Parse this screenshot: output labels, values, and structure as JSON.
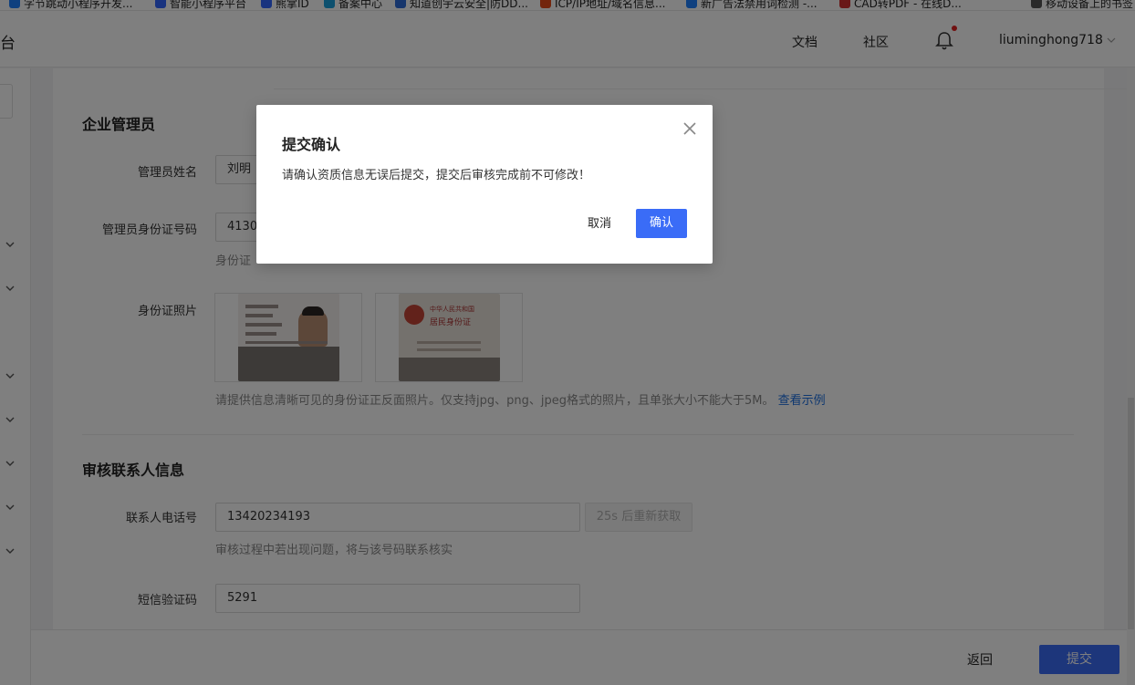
{
  "bookmarks": [
    {
      "label": "字节跳动小程序开发...",
      "color": "#1e80ff"
    },
    {
      "label": "智能小程序平台",
      "color": "#3266ff"
    },
    {
      "label": "熊掌ID",
      "color": "#3266ff"
    },
    {
      "label": "备案中心",
      "color": "#1aa0dc"
    },
    {
      "label": "知道创宇云安全|防DD...",
      "color": "#2e6dd8"
    },
    {
      "label": "ICP/IP地址/域名信息...",
      "color": "#e64a19"
    },
    {
      "label": "新广告法禁用词检测 -...",
      "color": "#1e80ff"
    },
    {
      "label": "CAD转PDF - 在线D...",
      "color": "#d32f2f"
    },
    {
      "label": "移动设备上的书签",
      "color": "#555555"
    }
  ],
  "header": {
    "brand": "台",
    "nav_docs": "文档",
    "nav_community": "社区",
    "username": "liuminghong718"
  },
  "sections": {
    "admin_title": "企业管理员",
    "contact_title": "审核联系人信息"
  },
  "form": {
    "admin_name_label": "管理员姓名",
    "admin_name_value": "刘明",
    "admin_id_label": "管理员身份证号码",
    "admin_id_value": "4130",
    "admin_id_hint": "身份证",
    "id_photo_label": "身份证照片",
    "id_photo_hint": "请提供信息清晰可见的身份证正反面照片。仅支持jpg、png、jpeg格式的照片，且单张大小不能大于5M。",
    "id_photo_example_link": "查看示例",
    "id_back_text_1": "中华人民共和国",
    "id_back_text_2": "居民身份证",
    "phone_label": "联系人电话号",
    "phone_value": "13420234193",
    "sms_button": "25s 后重新获取",
    "phone_hint": "审核过程中若出现问题，将与该号码联系核实",
    "sms_code_label": "短信验证码",
    "sms_code_value": "5291"
  },
  "footer": {
    "back": "返回",
    "submit": "提交"
  },
  "modal": {
    "title": "提交确认",
    "body": "请确认资质信息无误后提交，提交后审核完成前不可修改！",
    "cancel": "取消",
    "confirm": "确认"
  },
  "colors": {
    "primary": "#3a6cf7",
    "link": "#1c6fe0",
    "notification_dot": "#e02020"
  },
  "icons": [
    "bell-icon",
    "chevron-down-icon",
    "close-icon"
  ]
}
